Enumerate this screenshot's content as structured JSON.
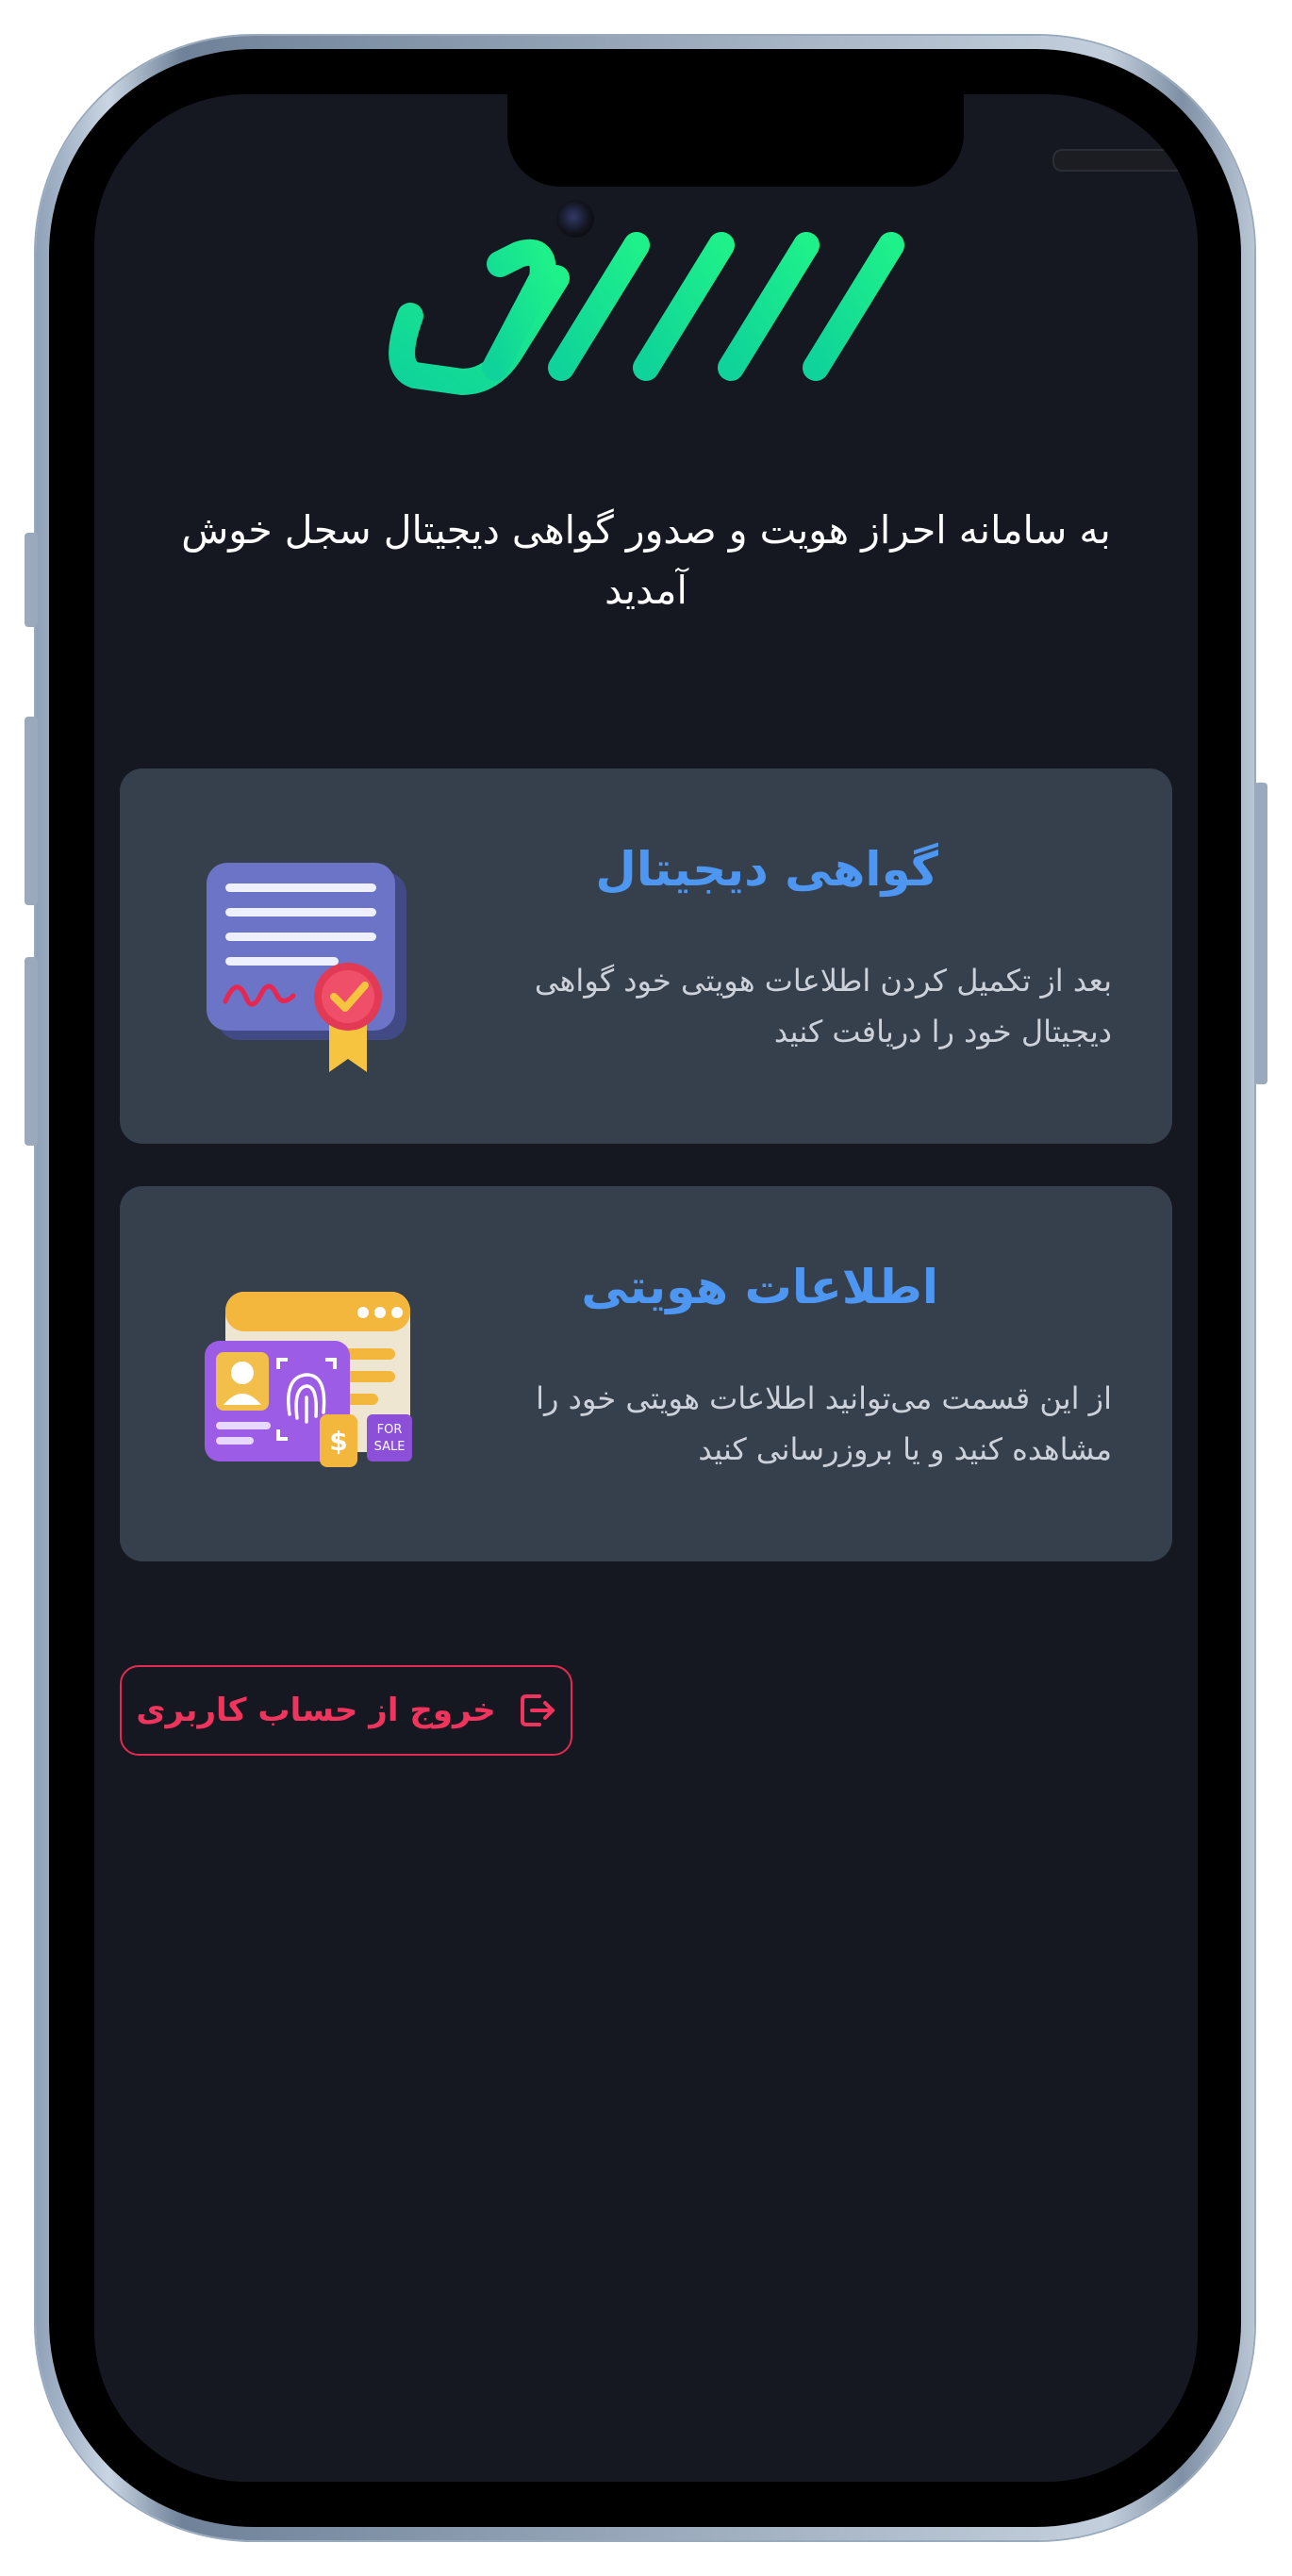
{
  "welcome": {
    "text": "به سامانه احراز هویت و صدور گواهی دیجیتال سجل خوش آمدید"
  },
  "cards": [
    {
      "title": "گواهی دیجیتال",
      "description": "بعد از تکمیل کردن اطلاعات هویتی خود گواهی دیجیتال خود را دریافت کنید",
      "icon": "certificate-icon"
    },
    {
      "title": "اطلاعات هویتی",
      "description": "از این قسمت می‌توانید اطلاعات هویتی خود را مشاهده کنید و یا بروزرسانی کنید",
      "icon": "identity-card-icon"
    }
  ],
  "logout": {
    "label": "خروج از حساب کاربری",
    "icon": "logout-icon"
  },
  "colors": {
    "background": "#151820",
    "card": "#363f4c",
    "accent_blue": "#4d97f3",
    "logo_green": "#11d98b",
    "danger": "#e22a52"
  }
}
